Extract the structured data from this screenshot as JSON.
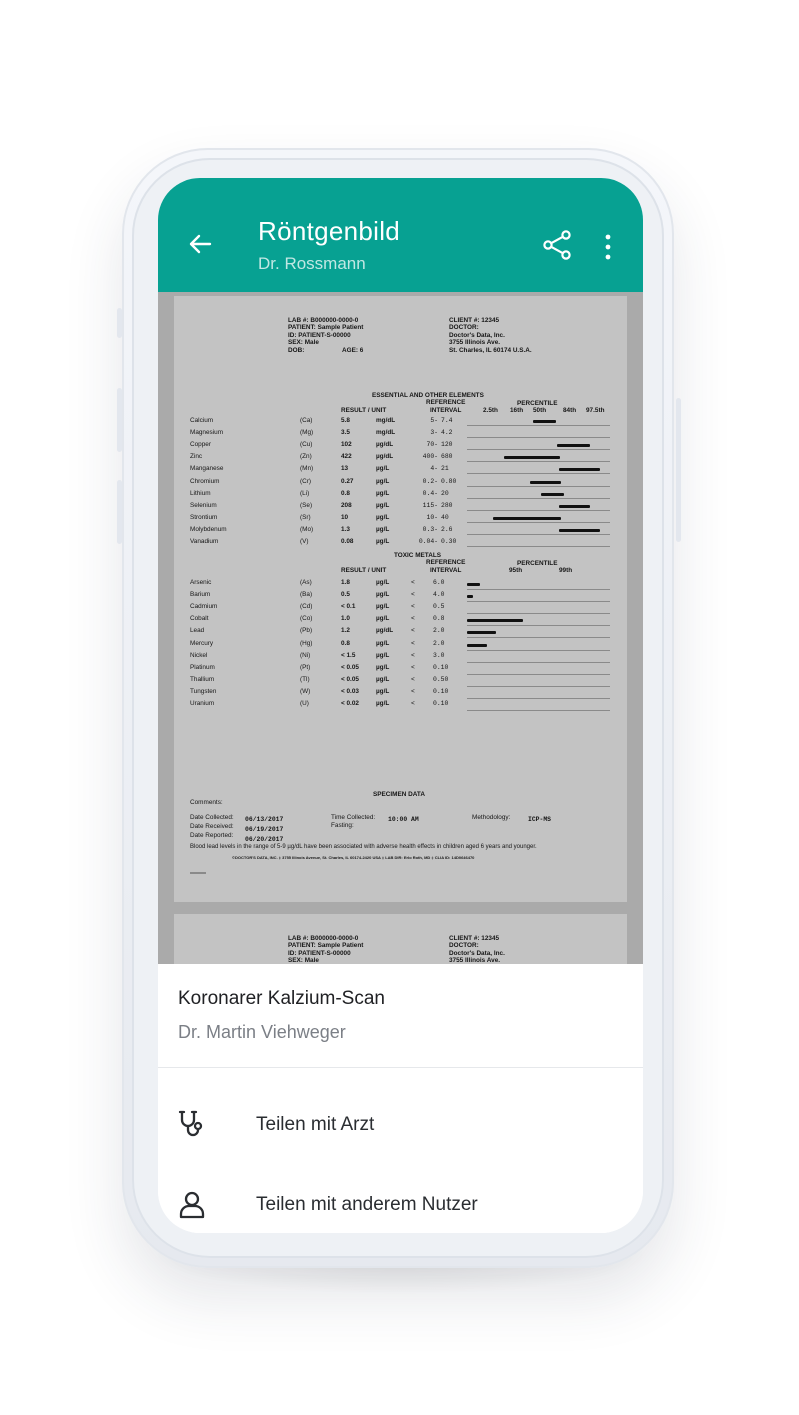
{
  "app_bar": {
    "title": "Röntgenbild",
    "subtitle": "Dr. Rossmann",
    "back_icon": "arrow-left-icon",
    "share_icon": "share-icon",
    "more_icon": "more-vert-icon",
    "color": "#07a192"
  },
  "document": {
    "page1": {
      "header_left": [
        "LAB #: B000000-0000-0",
        "PATIENT: Sample Patient",
        "ID: PATIENT-S-00000",
        "SEX: Male",
        "DOB:"
      ],
      "age": "AGE: 6",
      "header_right": [
        "CLIENT #: 12345",
        "DOCTOR:",
        "Doctor's Data, Inc.",
        "3755 Illinois Ave.",
        "St. Charles, IL 60174 U.S.A."
      ],
      "essential": {
        "section_title": "ESSENTIAL AND OTHER ELEMENTS",
        "reference_label": "REFERENCE",
        "result_unit_label": "RESULT / UNIT",
        "interval_label": "INTERVAL",
        "percentile_label": "PERCENTILE",
        "percentiles": [
          "2.5th",
          "16th",
          "50th",
          "84th",
          "97.5th"
        ],
        "rows": [
          {
            "name": "Calcium",
            "sym": "(Ca)",
            "result": "5.8",
            "unit": "mg/dL",
            "lo": "5-",
            "hi": "7.4",
            "bar": [
              0.46,
              0.62
            ]
          },
          {
            "name": "Magnesium",
            "sym": "(Mg)",
            "result": "3.5",
            "unit": "mg/dL",
            "lo": "3-",
            "hi": "4.2",
            "bar": [
              0.0,
              0.0
            ]
          },
          {
            "name": "Copper",
            "sym": "(Cu)",
            "result": "102",
            "unit": "µg/dL",
            "lo": "70-",
            "hi": "120",
            "bar": [
              0.63,
              0.86
            ]
          },
          {
            "name": "Zinc",
            "sym": "(Zn)",
            "result": "422",
            "unit": "µg/dL",
            "lo": "400-",
            "hi": "680",
            "bar": [
              0.26,
              0.65
            ]
          },
          {
            "name": "Manganese",
            "sym": "(Mn)",
            "result": "13",
            "unit": "µg/L",
            "lo": "4-",
            "hi": "21",
            "bar": [
              0.64,
              0.93
            ]
          },
          {
            "name": "Chromium",
            "sym": "(Cr)",
            "result": "0.27",
            "unit": "µg/L",
            "lo": "0.2-",
            "hi": "0.80",
            "bar": [
              0.44,
              0.66
            ]
          },
          {
            "name": "Lithium",
            "sym": "(Li)",
            "result": "0.8",
            "unit": "µg/L",
            "lo": "0.4-",
            "hi": "20",
            "bar": [
              0.52,
              0.68
            ]
          },
          {
            "name": "Selenium",
            "sym": "(Se)",
            "result": "208",
            "unit": "µg/L",
            "lo": "115-",
            "hi": "280",
            "bar": [
              0.64,
              0.86
            ]
          },
          {
            "name": "Strontium",
            "sym": "(Sr)",
            "result": "10",
            "unit": "µg/L",
            "lo": "10-",
            "hi": "40",
            "bar": [
              0.18,
              0.66
            ]
          },
          {
            "name": "Molybdenum",
            "sym": "(Mo)",
            "result": "1.3",
            "unit": "µg/L",
            "lo": "0.3-",
            "hi": "2.6",
            "bar": [
              0.64,
              0.93
            ]
          },
          {
            "name": "Vanadium",
            "sym": "(V)",
            "result": "0.08",
            "unit": "µg/L",
            "lo": "0.04-",
            "hi": "0.30",
            "bar": [
              0.0,
              0.0
            ]
          }
        ]
      },
      "toxic": {
        "section_title": "TOXIC METALS",
        "reference_label": "REFERENCE",
        "result_unit_label": "RESULT / UNIT",
        "interval_label": "INTERVAL",
        "percentile_label": "PERCENTILE",
        "percentiles": [
          "95th",
          "99th"
        ],
        "rows": [
          {
            "name": "Arsenic",
            "sym": "(As)",
            "result": "1.8",
            "unit": "µg/L",
            "lt": "<",
            "ref": "6.0",
            "bar": [
              0.0,
              0.09
            ]
          },
          {
            "name": "Barium",
            "sym": "(Ba)",
            "result": "0.5",
            "unit": "µg/L",
            "lt": "<",
            "ref": "4.0",
            "bar": [
              0.0,
              0.04
            ]
          },
          {
            "name": "Cadmium",
            "sym": "(Cd)",
            "result": "< 0.1",
            "unit": "µg/L",
            "lt": "<",
            "ref": "0.5",
            "bar": [
              0.0,
              0.0
            ]
          },
          {
            "name": "Cobalt",
            "sym": "(Co)",
            "result": "1.0",
            "unit": "µg/L",
            "lt": "<",
            "ref": "0.8",
            "bar": [
              0.0,
              0.39
            ]
          },
          {
            "name": "Lead",
            "sym": "(Pb)",
            "result": "1.2",
            "unit": "µg/dL",
            "lt": "<",
            "ref": "2.0",
            "bar": [
              0.0,
              0.2
            ]
          },
          {
            "name": "Mercury",
            "sym": "(Hg)",
            "result": "0.8",
            "unit": "µg/L",
            "lt": "<",
            "ref": "2.0",
            "bar": [
              0.0,
              0.14
            ]
          },
          {
            "name": "Nickel",
            "sym": "(Ni)",
            "result": "< 1.5",
            "unit": "µg/L",
            "lt": "<",
            "ref": "3.0",
            "bar": [
              0.0,
              0.0
            ]
          },
          {
            "name": "Platinum",
            "sym": "(Pt)",
            "result": "< 0.05",
            "unit": "µg/L",
            "lt": "<",
            "ref": "0.10",
            "bar": [
              0.0,
              0.0
            ]
          },
          {
            "name": "Thallium",
            "sym": "(Tl)",
            "result": "< 0.05",
            "unit": "µg/L",
            "lt": "<",
            "ref": "0.50",
            "bar": [
              0.0,
              0.0
            ]
          },
          {
            "name": "Tungsten",
            "sym": "(W)",
            "result": "< 0.03",
            "unit": "µg/L",
            "lt": "<",
            "ref": "0.10",
            "bar": [
              0.0,
              0.0
            ]
          },
          {
            "name": "Uranium",
            "sym": "(U)",
            "result": "< 0.02",
            "unit": "µg/L",
            "lt": "<",
            "ref": "0.10",
            "bar": [
              0.0,
              0.0
            ]
          }
        ]
      },
      "specimen_title": "SPECIMEN DATA",
      "comments_label": "Comments:",
      "date_collected_label": "Date Collected:",
      "date_collected": "06/13/2017",
      "date_received_label": "Date Received:",
      "date_received": "06/19/2017",
      "date_reported_label": "Date Reported:",
      "date_reported": "06/20/2017",
      "time_collected_label": "Time Collected:",
      "time_collected": "10:00 AM",
      "fasting_label": "Fasting:",
      "methodology_label": "Methodology:",
      "methodology": "ICP-MS",
      "blood_lead_note": "Blood lead levels in the range of 5-9 µg/dL have been associated with adverse health effects in children aged 6 years and younger.",
      "footer": "©DOCTOR'S DATA, INC.  ‡  3755 Illinois Avenue, St. Charles, IL 60174-2420 USA  ‡  LAB DIR: Erlo Roth, MD  ‡  CLIA ID: 14D0646470"
    },
    "page2": {
      "header_left": [
        "LAB #: B000000-0000-0",
        "PATIENT: Sample Patient",
        "ID: PATIENT-S-00000",
        "SEX: Male"
      ],
      "header_right": [
        "CLIENT #: 12345",
        "DOCTOR:",
        "Doctor's Data, Inc.",
        "3755 Illinois Ave."
      ]
    }
  },
  "bottom_sheet": {
    "title": "Koronarer Kalzium-Scan",
    "subtitle": "Dr. Martin Viehweger",
    "actions": [
      {
        "label": "Teilen mit Arzt",
        "icon": "stethoscope-icon"
      },
      {
        "label": "Teilen mit anderem Nutzer",
        "icon": "user-icon"
      }
    ]
  }
}
